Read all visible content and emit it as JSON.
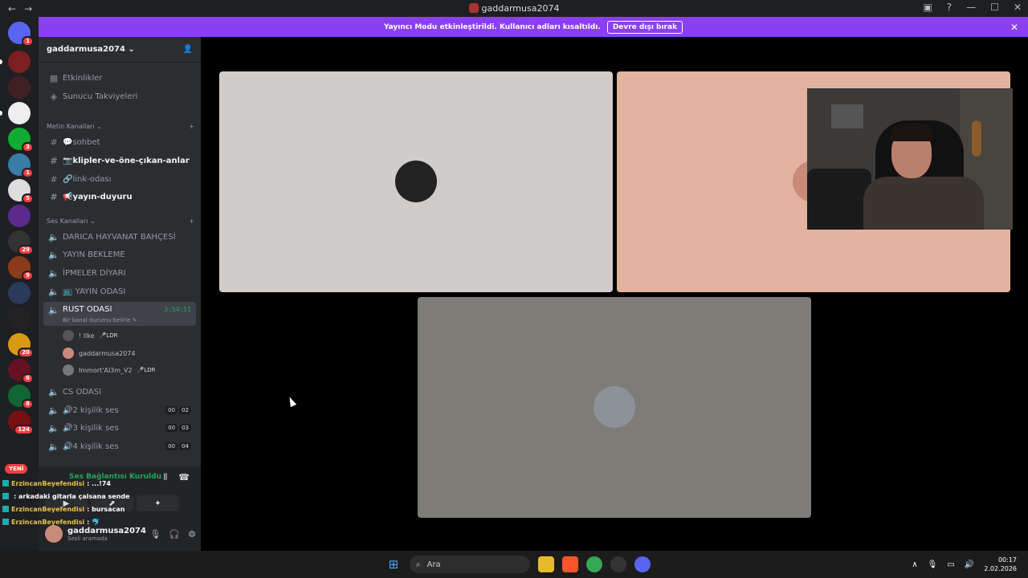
{
  "window": {
    "title": "gaddarmusa2074"
  },
  "banner": {
    "text": "Yayıncı Modu etkinleştirildi. Kullanıcı adları kısaltıldı.",
    "button": "Devre dışı bırak"
  },
  "server": {
    "name": "gaddarmusa2074 ⌄"
  },
  "sidebar": {
    "top_items": [
      {
        "label": "Etkinlikler"
      },
      {
        "label": "Sunucu Takviyeleri"
      }
    ],
    "text_category": "Metin Kanalları ⌄",
    "text_channels": [
      {
        "label": "💬sohbet"
      },
      {
        "label": "📷klipler-ve-öne-çıkan-anlar"
      },
      {
        "label": "🔗link-odası"
      },
      {
        "label": "📢yayın-duyuru"
      }
    ],
    "voice_category": "Ses Kanalları ⌄",
    "voice_channels": [
      {
        "label": "DARICA HAYVANAT BAHÇESİ"
      },
      {
        "label": "YAYIN BEKLEME"
      },
      {
        "label": "İPMELER DİYARI"
      },
      {
        "label": "📺 YAYIN ODASI"
      },
      {
        "label": "RUST ODASI"
      }
    ],
    "rust_timer": "3:54:51",
    "rust_status": "Bir kanal durumu belirle ✎",
    "members": [
      {
        "name": "! Ilke",
        "tag": "🎤LDR"
      },
      {
        "name": "gaddarmusa2074",
        "tag": ""
      },
      {
        "name": "Immort'Al3m_V2",
        "tag": "🎤LDR"
      }
    ],
    "more_channels": [
      {
        "label": "CS ODASI",
        "c1": "",
        "c2": ""
      },
      {
        "label": "🔊2 kişilik ses",
        "c1": "00",
        "c2": "02"
      },
      {
        "label": "🔊3 kişilik ses",
        "c1": "00",
        "c2": "03"
      },
      {
        "label": "🔊4 kişilik ses",
        "c1": "00",
        "c2": "04"
      }
    ]
  },
  "voice_panel": {
    "status": "Ses Bağlantısı Kuruldu"
  },
  "user": {
    "name": "gaddarmusa2074",
    "status": "Sesli aramada"
  },
  "chat": [
    {
      "name": "ErzincanBeyefendisi",
      "msg": ": ...!74"
    },
    {
      "name": "",
      "msg": ": arkadaki gitarla çalsana sende"
    },
    {
      "name": "ErzincanBeyefendisi",
      "msg": ": bursacan"
    },
    {
      "name": "ErzincanBeyefendisi",
      "msg": ": 🐬"
    }
  ],
  "servers": {
    "badges": [
      "1",
      "1",
      "3",
      "1",
      "5",
      "29",
      "9",
      "20",
      "6",
      "8",
      "124"
    ],
    "new_label": "YENİ"
  },
  "taskbar": {
    "search": "Ara",
    "time": "00:17",
    "date": "2.02.2026"
  },
  "colors": {
    "accent": "#8a3ff2",
    "online": "#23a55a",
    "danger": "#f23f43"
  }
}
